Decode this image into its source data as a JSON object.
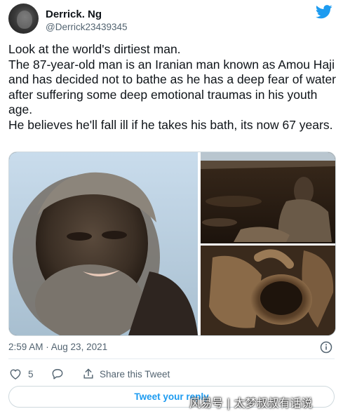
{
  "author": {
    "display_name": "Derrick. Ng",
    "handle": "@Derrick23439345"
  },
  "tweet": {
    "text": "Look at the world's dirtiest man.\nThe 87-year-old man is an Iranian man known as Amou Haji and has decided not to bathe as he has a deep fear of water after suffering some deep emotional traumas in his youth age.\nHe believes he'll fall ill if he takes his bath, its now 67 years.",
    "timestamp": "2:59 AM · Aug 23, 2021"
  },
  "actions": {
    "like_count": "5",
    "share_label": "Share this Tweet"
  },
  "reply": {
    "button_label": "Tweet your reply"
  },
  "watermark": "风易号 | 太梦叔叔有话说",
  "colors": {
    "twitter_blue": "#1d9bf0",
    "text": "#0f1419",
    "secondary_text": "#536471"
  },
  "icons": [
    "twitter-bird-icon",
    "info-icon",
    "heart-icon",
    "reply-icon",
    "share-icon"
  ]
}
